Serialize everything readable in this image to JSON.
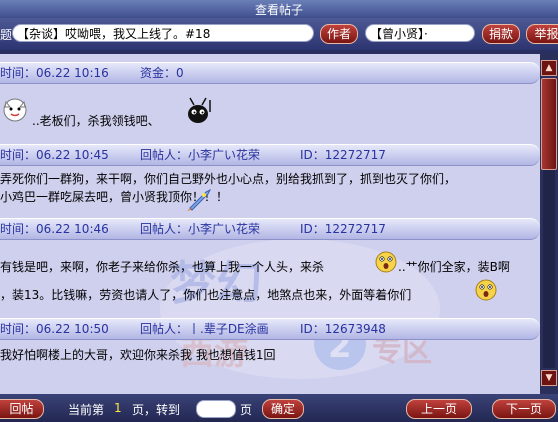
{
  "window": {
    "title": "查看帖子"
  },
  "topbar": {
    "topic_label": "题",
    "topic_value": "【杂谈】哎呦喂，我又上线了。#18",
    "author_button": "作者",
    "author_value": "【曾小贤】·",
    "donate_button": "捐款",
    "report_button": "举报"
  },
  "posts": [
    {
      "time": "时间：06.22 10:16",
      "extra": "资金：0",
      "lines": [
        "..老板们，杀我领钱吧、"
      ]
    },
    {
      "time": "时间：06.22 10:45",
      "replier": "回帖人：小李广い花荣",
      "id": "ID：12272717",
      "lines": [
        "弄死你们一群狗，来干啊，你们自己野外也小心点，别给我抓到了，抓到也灭了你们，",
        "小鸡巴一群吃屎去吧，曾小贤我顶你！！！"
      ]
    },
    {
      "time": "时间：06.22 10:46",
      "replier": "回帖人：小李广い花荣",
      "id": "ID：12272717",
      "lines": [
        "有钱是吧，来啊，你老子来给你杀，也算上我一个人头，来杀",
        "..艹你们全家，装B啊",
        "，装13。比钱嘛，劳资也请人了，你们也注意点，地煞点也来，外面等着你们"
      ]
    },
    {
      "time": "时间：06.22 10:50",
      "replier": "回帖人：丨.辈子DE涂画",
      "id": "ID：12673948",
      "lines": [
        "我好怕啊楼上的大哥，欢迎你来杀我  我也想值钱1回"
      ]
    }
  ],
  "watermark": {
    "text": "梦幻西游2专区"
  },
  "bottombar": {
    "reply_button": "回帖",
    "current_prefix": "当前第",
    "current_page": "1",
    "page_goto": "页，转到",
    "page_suffix": "页",
    "confirm_button": "确定",
    "prev_button": "上一页",
    "next_button": "下一页"
  },
  "colors": {
    "content_bg": "#cfd0ee",
    "header_text": "#2832a0",
    "button_red": "#a4302a",
    "page_number": "#ffe44a"
  }
}
